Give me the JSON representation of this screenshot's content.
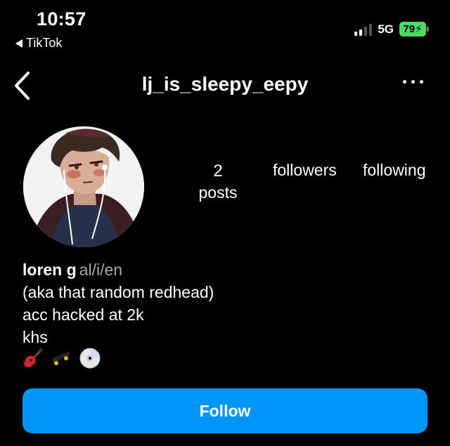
{
  "status_bar": {
    "time": "10:57",
    "back_app": "TikTok",
    "network": "5G",
    "battery": "79"
  },
  "header": {
    "username": "lj_is_sleepy_eepy"
  },
  "stats": {
    "posts_count": "2",
    "posts_label": "posts",
    "followers_label": "followers",
    "following_label": "following"
  },
  "bio": {
    "name": "loren g",
    "pronouns": "al/i/en",
    "lines": [
      "(aka that random redhead)",
      "acc hacked at 2k",
      "khs"
    ],
    "emojis": [
      "guitar-emoji",
      "skateboard-emoji",
      "cd-emoji"
    ]
  },
  "actions": {
    "follow_label": "Follow"
  },
  "colors": {
    "background": "#000000",
    "follow_button": "#0095f6",
    "battery": "#4cd964",
    "pronouns": "#a8a8a8"
  }
}
